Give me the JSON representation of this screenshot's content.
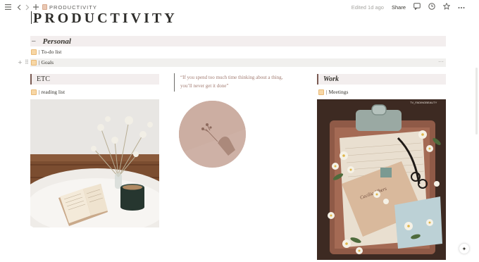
{
  "topbar": {
    "breadcrumb_title": "PRODUCTIVITY",
    "edited": "Edited 1d ago",
    "share": "Share"
  },
  "page": {
    "title": "PRODUCTIVITY"
  },
  "personal": {
    "heading": "Personal",
    "items": [
      {
        "label": "To-do list"
      },
      {
        "label": "Goals"
      }
    ]
  },
  "columns": {
    "etc": {
      "heading": "ETC",
      "item": "reading list"
    },
    "quote": {
      "text": "“If you spend too much time thinking about a thing, you’ll never get it done”"
    },
    "work": {
      "heading": "Work",
      "item": "Meetings",
      "image_caption": "TV_FADINGBEAUTY"
    }
  },
  "icons": {
    "menu": "hamburger-icon",
    "back": "chevron-left-icon",
    "forward": "chevron-right-icon",
    "add": "plus-icon",
    "comment": "comment-icon",
    "updates": "clock-icon",
    "favorite": "star-icon",
    "more": "more-icon",
    "help": "sparkle-icon"
  },
  "colors": {
    "section_bg": "#f3eeee",
    "section_border": "#7a5a52",
    "quote_text": "#a27c72"
  }
}
